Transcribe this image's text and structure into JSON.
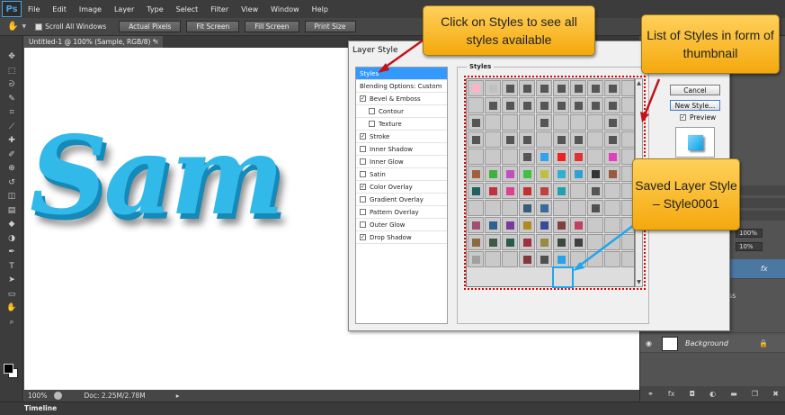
{
  "menubar": {
    "logo": "Ps",
    "items": [
      "File",
      "Edit",
      "Image",
      "Layer",
      "Type",
      "Select",
      "Filter",
      "View",
      "Window",
      "Help"
    ]
  },
  "options": {
    "scroll_all": "Scroll All Windows",
    "buttons": [
      "Actual Pixels",
      "Fit Screen",
      "Fill Screen",
      "Print Size"
    ]
  },
  "document": {
    "tab_title": "Untitled-1 @ 100% (Sample, RGB/8) *",
    "tab_close": "×",
    "canvas_text": "Sam"
  },
  "status": {
    "zoom": "100%",
    "doc_info": "Doc: 2.25M/2.78M",
    "arrow": "▸",
    "timeline_label": "Timeline"
  },
  "layers": {
    "opacity": "100%",
    "fill": "10%",
    "fx": "fx",
    "background_label": "Background",
    "partial_text": "ss"
  },
  "dialog": {
    "title": "Layer Style",
    "styles_legend": "Styles",
    "left_items": [
      {
        "label": "Styles",
        "type": "header"
      },
      {
        "label": "Blending Options: Custom",
        "type": "plain"
      },
      {
        "label": "Bevel & Emboss",
        "type": "checked"
      },
      {
        "label": "Contour",
        "type": "sub"
      },
      {
        "label": "Texture",
        "type": "sub"
      },
      {
        "label": "Stroke",
        "type": "checked"
      },
      {
        "label": "Inner Shadow",
        "type": "unchecked"
      },
      {
        "label": "Inner Glow",
        "type": "unchecked"
      },
      {
        "label": "Satin",
        "type": "unchecked"
      },
      {
        "label": "Color Overlay",
        "type": "checked"
      },
      {
        "label": "Gradient Overlay",
        "type": "unchecked"
      },
      {
        "label": "Pattern Overlay",
        "type": "unchecked"
      },
      {
        "label": "Outer Glow",
        "type": "unchecked"
      },
      {
        "label": "Drop Shadow",
        "type": "checked"
      }
    ],
    "buttons": {
      "cancel": "Cancel",
      "new_style": "New Style...",
      "preview": "Preview"
    },
    "check_mark": "✓",
    "scroll_up": "▲",
    "scroll_down": "▼"
  },
  "callouts": {
    "styles": "Click on Styles to see all styles available",
    "thumbnails": "List of Styles in form of thumbnail",
    "saved": "Saved Layer Style – Style0001"
  },
  "colors": {
    "accent_blue": "#3399ff",
    "canvas_text": "#31b9ea",
    "callout": "#f4a90d",
    "dotted_frame": "#e00000",
    "saved_highlight": "#1fa6ef"
  },
  "tool_icons": [
    "move-icon",
    "marquee-icon",
    "lasso-icon",
    "quick-select-icon",
    "crop-icon",
    "eyedropper-icon",
    "healing-icon",
    "brush-icon",
    "stamp-icon",
    "history-brush-icon",
    "eraser-icon",
    "gradient-icon",
    "blur-icon",
    "dodge-icon",
    "pen-icon",
    "type-icon",
    "path-select-icon",
    "shape-icon",
    "hand-icon",
    "zoom-icon"
  ],
  "tool_glyphs": [
    "✥",
    "⬚",
    "ᘐ",
    "✎",
    "⌗",
    "⟋",
    "✚",
    "✐",
    "⊕",
    "↺",
    "◫",
    "▤",
    "◆",
    "◑",
    "✒",
    "T",
    "➤",
    "▭",
    "✋",
    "⌕"
  ],
  "swatch_colors": [
    [
      "#ffb3c6",
      "#c0c0c0",
      "#555",
      "#555",
      "#555",
      "#555",
      "#555",
      "#555",
      "#555",
      "#c9c9c9"
    ],
    [
      "#c9c9c9",
      "#555",
      "#555",
      "#555",
      "#555",
      "#555",
      "#555",
      "#555",
      "#555",
      "#c9c9c9"
    ],
    [
      "#555",
      "#c9c9c9",
      "#c9c9c9",
      "#c9c9c9",
      "#555",
      "#c9c9c9",
      "#c9c9c9",
      "#c9c9c9",
      "#555",
      "#c9c9c9"
    ],
    [
      "#555",
      "#c9c9c9",
      "#555",
      "#555",
      "#c9c9c9",
      "#555",
      "#555",
      "#c9c9c9",
      "#555",
      "#c9c9c9"
    ],
    [
      "#c9c9c9",
      "#c9c9c9",
      "#c9c9c9",
      "#555",
      "#2fa3ef",
      "#ee2222",
      "#dd3333",
      "#c9c9c9",
      "#e040c0",
      "#c9c9c9"
    ],
    [
      "#a06040",
      "#40b040",
      "#c050c0",
      "#40c040",
      "#c0c040",
      "#30b0d0",
      "#30a0d0",
      "#333",
      "#9a5a40",
      "#c9c9c9"
    ],
    [
      "#206060",
      "#c03040",
      "#e04090",
      "#c03030",
      "#c04040",
      "#20a0b0",
      "#c9c9c9",
      "#555",
      "#c9c9c9",
      "#c9c9c9"
    ],
    [
      "#c9c9c9",
      "#c9c9c9",
      "#c9c9c9",
      "#3a5a7a",
      "#3a6a9a",
      "#c9c9c9",
      "#c9c9c9",
      "#505050",
      "#c9c9c9",
      "#c9c9c9"
    ],
    [
      "#a05070",
      "#306090",
      "#7a3a9a",
      "#b08a20",
      "#3a4a9a",
      "#804040",
      "#c04060",
      "#c9c9c9",
      "#c9c9c9",
      "#c9c9c9"
    ],
    [
      "#8a6a40",
      "#405a4a",
      "#2a5a4a",
      "#a03040",
      "#9a8a40",
      "#3a4a3a",
      "#404040",
      "#c9c9c9",
      "#c9c9c9",
      "#c9c9c9"
    ],
    [
      "#a0a0a0",
      "#c9c9c9",
      "#c9c9c9",
      "#803a3a",
      "#505050",
      "#2aa2ea",
      "#c9c9c9",
      "#c9c9c9",
      "#c9c9c9",
      "#c9c9c9"
    ]
  ]
}
